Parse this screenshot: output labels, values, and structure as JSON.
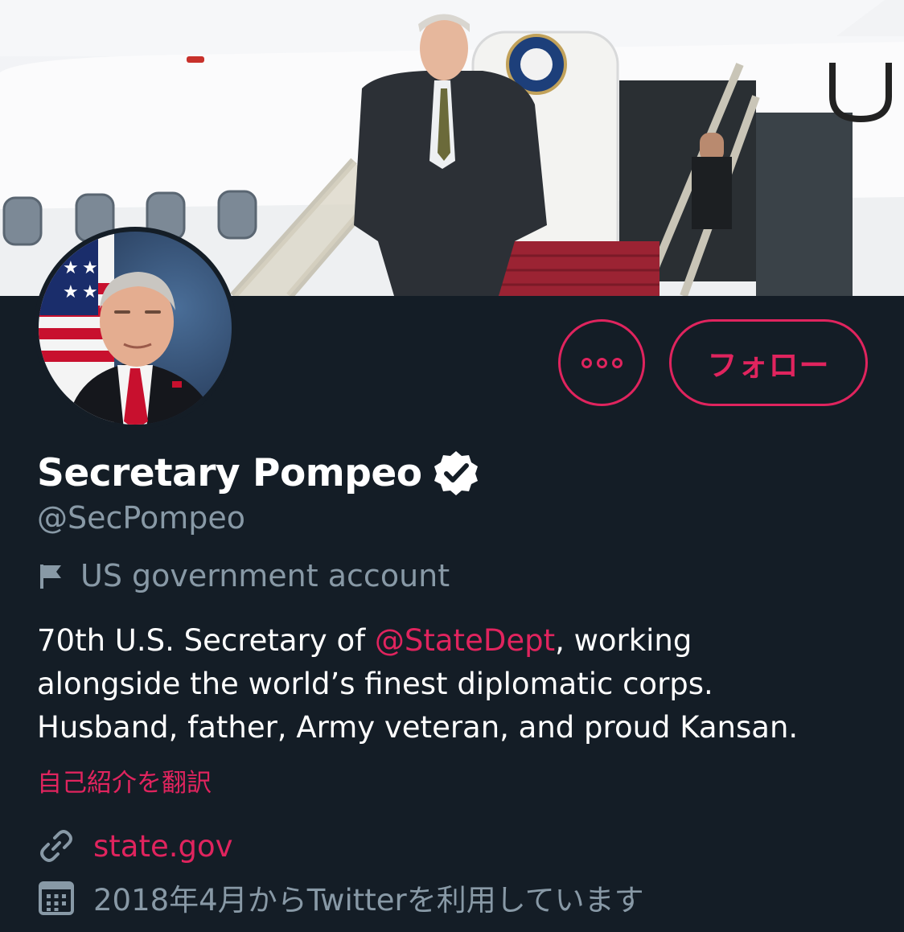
{
  "profile": {
    "display_name": "Secretary Pompeo",
    "handle": "@SecPompeo",
    "account_label": "US government account",
    "bio": {
      "line1_prefix": "70th U.S. Secretary of ",
      "mention": "@StateDept",
      "line1_suffix": ", working",
      "line2": "alongside the world’s finest diplomatic corps.",
      "line3": "Husband, father, Army veteran, and proud Kansan."
    },
    "translate_label": "自己紹介を翻訳",
    "website": "state.gov",
    "joined": "2018年4月からTwitterを利用しています",
    "verified": true
  },
  "actions": {
    "follow_label": "フォロー",
    "more_icon": "more-icon"
  },
  "icons": {
    "flag": "flag-icon",
    "link": "link-icon",
    "calendar": "calendar-icon",
    "verified": "verified-badge-icon"
  },
  "theme": {
    "background": "#141d26",
    "accent": "#e0245e",
    "muted": "#8899a6",
    "text": "#ffffff"
  }
}
